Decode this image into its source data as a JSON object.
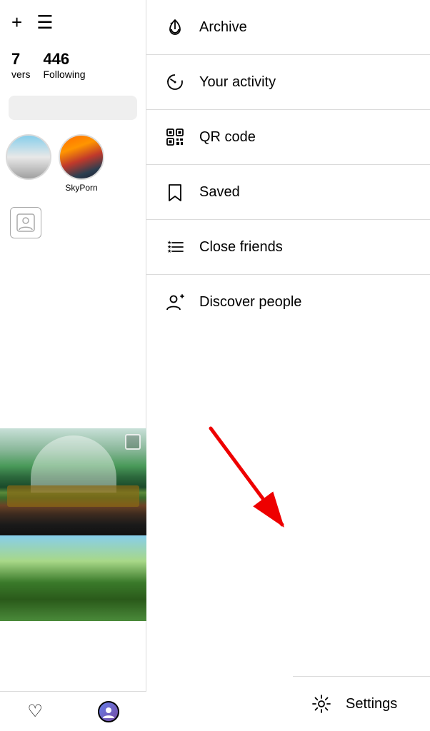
{
  "left": {
    "add_icon": "+",
    "menu_icon": "☰",
    "stat_partial": "7",
    "stat_partial_label": "vers",
    "stat_following": "446",
    "stat_following_label": "Following",
    "story_label": "SkyPorn"
  },
  "menu": {
    "items": [
      {
        "id": "archive",
        "label": "Archive"
      },
      {
        "id": "your-activity",
        "label": "Your activity"
      },
      {
        "id": "qr-code",
        "label": "QR code"
      },
      {
        "id": "saved",
        "label": "Saved"
      },
      {
        "id": "close-friends",
        "label": "Close friends"
      },
      {
        "id": "discover-people",
        "label": "Discover people"
      }
    ],
    "settings_label": "Settings"
  },
  "bottom_nav": {
    "heart_icon": "♡"
  }
}
